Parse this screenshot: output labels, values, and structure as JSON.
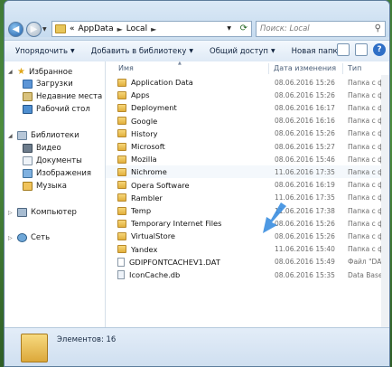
{
  "address": {
    "chevron": "«",
    "crumbs": [
      "AppData",
      "Local"
    ],
    "separator": "►"
  },
  "search": {
    "placeholder": "Поиск: Local"
  },
  "toolbar": {
    "organize": "Упорядочить",
    "add_to_library": "Добавить в библиотеку",
    "share": "Общий доступ",
    "new_folder": "Новая папка"
  },
  "nav": {
    "favorites": "Избранное",
    "downloads": "Загрузки",
    "recent": "Недавние места",
    "desktop": "Рабочий стол",
    "libraries": "Библиотеки",
    "video": "Видео",
    "documents": "Документы",
    "images": "Изображения",
    "music": "Музыка",
    "computer": "Компьютер",
    "network": "Сеть"
  },
  "columns": {
    "name": "Имя",
    "date": "Дата изменения",
    "type": "Тип"
  },
  "files": [
    {
      "name": "Application Data",
      "date": "08.06.2016 15:26",
      "type": "Папка с фа",
      "kind": "link-folder"
    },
    {
      "name": "Apps",
      "date": "08.06.2016 15:26",
      "type": "Папка с фа",
      "kind": "folder"
    },
    {
      "name": "Deployment",
      "date": "08.06.2016 16:17",
      "type": "Папка с фа",
      "kind": "folder"
    },
    {
      "name": "Google",
      "date": "08.06.2016 16:16",
      "type": "Папка с фа",
      "kind": "folder"
    },
    {
      "name": "History",
      "date": "08.06.2016 15:26",
      "type": "Папка с фа",
      "kind": "link-folder"
    },
    {
      "name": "Microsoft",
      "date": "08.06.2016 15:27",
      "type": "Папка с фа",
      "kind": "folder"
    },
    {
      "name": "Mozilla",
      "date": "08.06.2016 15:46",
      "type": "Папка с фа",
      "kind": "folder"
    },
    {
      "name": "Nichrome",
      "date": "11.06.2016 17:35",
      "type": "Папка с фа",
      "kind": "folder"
    },
    {
      "name": "Opera Software",
      "date": "08.06.2016 16:19",
      "type": "Папка с фа",
      "kind": "folder"
    },
    {
      "name": "Rambler",
      "date": "11.06.2016 17:35",
      "type": "Папка с фа",
      "kind": "folder"
    },
    {
      "name": "Temp",
      "date": "11.06.2016 17:38",
      "type": "Папка с фа",
      "kind": "folder"
    },
    {
      "name": "Temporary Internet Files",
      "date": "08.06.2016 15:26",
      "type": "Папка с фа",
      "kind": "link-folder"
    },
    {
      "name": "VirtualStore",
      "date": "08.06.2016 15:26",
      "type": "Папка с фа",
      "kind": "folder"
    },
    {
      "name": "Yandex",
      "date": "11.06.2016 15:40",
      "type": "Папка с фа",
      "kind": "folder"
    },
    {
      "name": "GDIPFONTCACHEV1.DAT",
      "date": "08.06.2016 15:49",
      "type": "Файл \"DAT\"",
      "kind": "file"
    },
    {
      "name": "IconCache.db",
      "date": "08.06.2016 15:35",
      "type": "Data Base Fil",
      "kind": "file"
    }
  ],
  "status": {
    "count": "Элементов: 16"
  }
}
